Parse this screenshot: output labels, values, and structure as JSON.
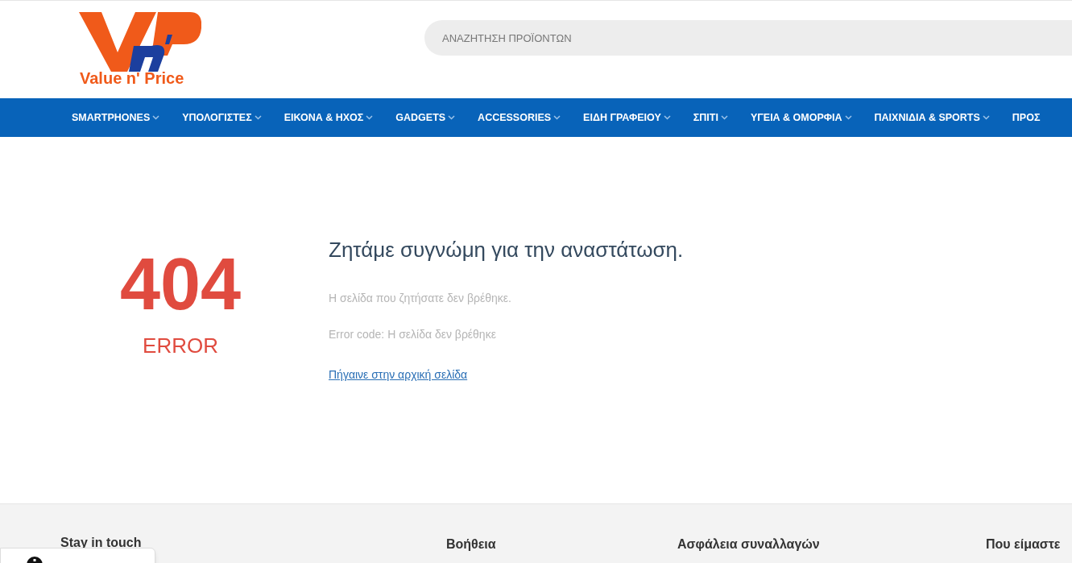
{
  "logo": {
    "text": "Value n' Price"
  },
  "search": {
    "placeholder": "ΑΝΑΖΗΤΗΣΗ ΠΡΟΪΟΝΤΩΝ"
  },
  "nav": [
    {
      "label": "SMARTPHONES",
      "dropdown": true
    },
    {
      "label": "ΥΠΟΛΟΓΙΣΤΕΣ",
      "dropdown": true
    },
    {
      "label": "ΕΙΚΟΝΑ & ΗΧΟΣ",
      "dropdown": true
    },
    {
      "label": "GADGETS",
      "dropdown": true
    },
    {
      "label": "ACCESSORIES",
      "dropdown": true
    },
    {
      "label": "ΕΙΔΗ ΓΡΑΦΕΙΟΥ",
      "dropdown": true
    },
    {
      "label": "ΣΠΙΤΙ",
      "dropdown": true
    },
    {
      "label": "ΥΓΕΙΑ & ΟΜΟΡΦΙΑ",
      "dropdown": true
    },
    {
      "label": "ΠΑΙΧΝΙΔΙΑ & SPORTS",
      "dropdown": true
    },
    {
      "label": "ΠΡΟΣ",
      "dropdown": false
    }
  ],
  "error": {
    "code": "404",
    "label": "ERROR",
    "heading": "Ζητάμε συγνώμη για την αναστάτωση.",
    "messages": [
      "Η σελίδα που ζητήσατε δεν βρέθηκε.",
      "Error code: Η σελίδα δεν βρέθηκε"
    ],
    "link": "Πήγαινε στην αρχική σελίδα"
  },
  "footer": {
    "headings": [
      "Stay in touch",
      "Βοήθεια",
      "Ασφάλεια συναλλαγών",
      "Που είμαστε"
    ]
  }
}
